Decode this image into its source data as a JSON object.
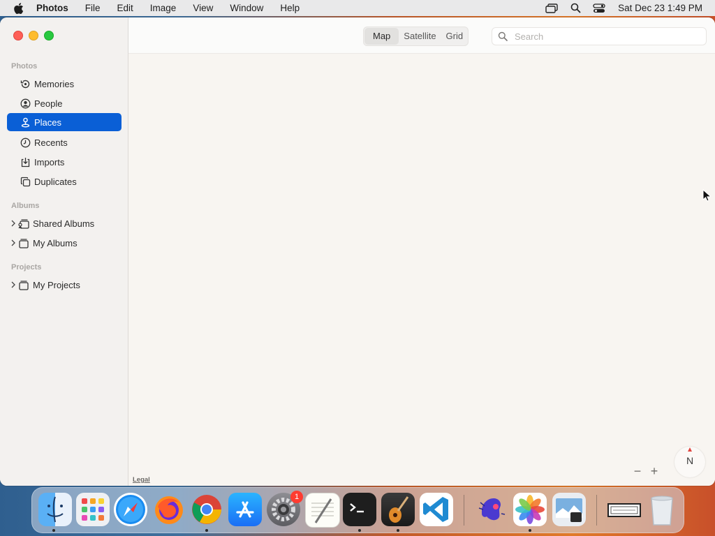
{
  "menubar": {
    "app_name": "Photos",
    "items": [
      "File",
      "Edit",
      "Image",
      "View",
      "Window",
      "Help"
    ],
    "clock": "Sat Dec 23  1:49 PM"
  },
  "sidebar": {
    "sections": [
      {
        "title": "Photos",
        "items": [
          {
            "label": "Memories",
            "icon": "memories-icon"
          },
          {
            "label": "People",
            "icon": "people-icon"
          },
          {
            "label": "Places",
            "icon": "places-icon",
            "selected": true
          },
          {
            "label": "Recents",
            "icon": "clock-icon"
          },
          {
            "label": "Imports",
            "icon": "import-icon"
          },
          {
            "label": "Duplicates",
            "icon": "duplicates-icon"
          }
        ]
      },
      {
        "title": "Albums",
        "items": [
          {
            "label": "Shared Albums",
            "icon": "shared-albums-icon"
          },
          {
            "label": "My Albums",
            "icon": "albums-icon"
          }
        ]
      },
      {
        "title": "Projects",
        "items": [
          {
            "label": "My Projects",
            "icon": "projects-icon"
          }
        ]
      }
    ]
  },
  "toolbar": {
    "segments": [
      "Map",
      "Satellite",
      "Grid"
    ],
    "selected_segment": "Map",
    "search_placeholder": "Search",
    "search_value": ""
  },
  "map": {
    "legal_label": "Legal",
    "zoom_out": "−",
    "zoom_in": "+",
    "compass_label": "N"
  },
  "dock": {
    "apps": [
      "Finder",
      "Launchpad",
      "Safari",
      "Firefox",
      "Chrome",
      "App Store",
      "System Settings",
      "TextEdit",
      "Terminal",
      "GarageBand",
      "Visual Studio Code",
      "Spectrum",
      "Photos",
      "Preview",
      "Scanner",
      "Trash"
    ],
    "system_settings_badge": "1"
  },
  "colors": {
    "selection": "#0a5fd6",
    "map_background": "#f8f5f1"
  }
}
